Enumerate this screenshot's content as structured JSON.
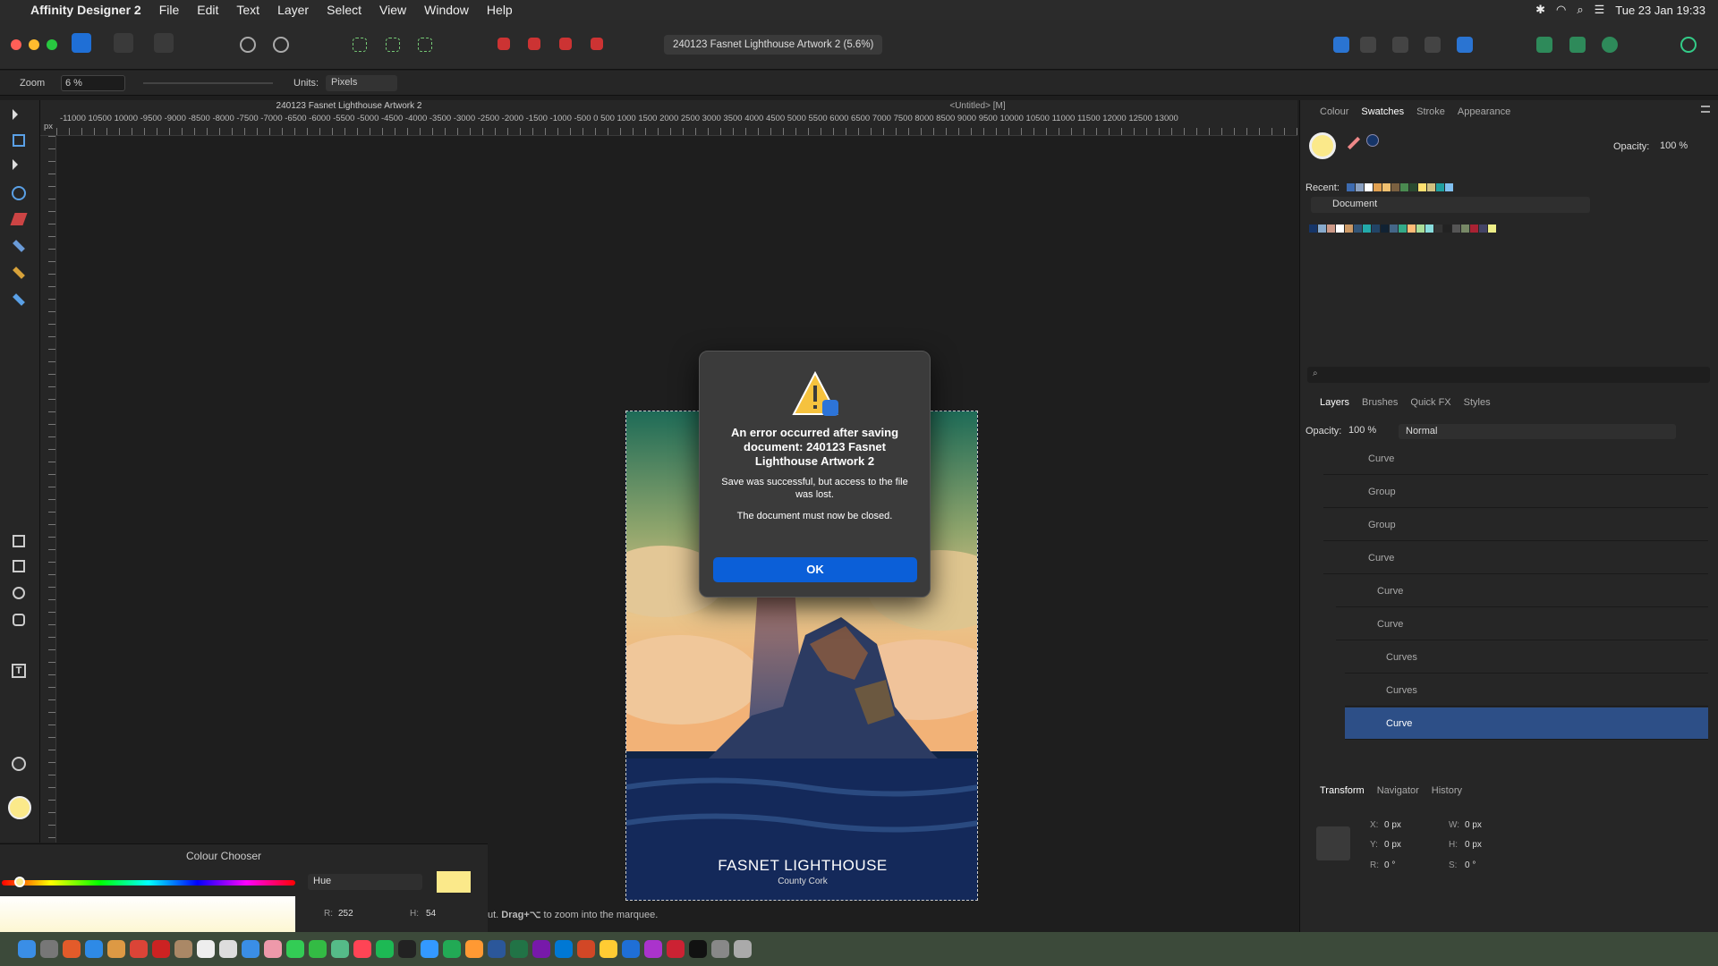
{
  "menubar": {
    "app": "Affinity Designer 2",
    "items": [
      "File",
      "Edit",
      "Text",
      "Layer",
      "Select",
      "View",
      "Window",
      "Help"
    ],
    "datetime": "Tue 23 Jan  19:33"
  },
  "toolbar": {
    "doc_title": "240123 Fasnet Lighthouse Artwork 2 (5.6%)"
  },
  "context": {
    "zoom_label": "Zoom",
    "zoom_value": "6 %",
    "units_label": "Units:",
    "units_value": "Pixels"
  },
  "tabs": {
    "active": "240123 Fasnet Lighthouse Artwork 2",
    "other": "<Untitled> [M]"
  },
  "ruler": {
    "unit": "px",
    "labels": "-11000 10500 10000 -9500 -9000 -8500 -8000 -7500 -7000 -6500 -6000 -5500 -5000 -4500 -4000 -3500 -3000 -2500 -2000 -1500 -1000 -500   0   500  1000  1500  2000  2500  3000  3500  4000  4500  5000  5500  6000  6500  7000  7500  8000  8500  9000  9500 10000 10500 11000 11500 12000 12500 13000"
  },
  "swatches_panel": {
    "tabs": [
      "Colour",
      "Swatches",
      "Stroke",
      "Appearance"
    ],
    "active": "Swatches",
    "opacity_label": "Opacity:",
    "opacity_value": "100 %",
    "recent_label": "Recent:",
    "palette": "Document"
  },
  "layers_panel": {
    "tabs": [
      "Layers",
      "Brushes",
      "Quick FX",
      "Styles"
    ],
    "active": "Layers",
    "opacity_label": "Opacity:",
    "opacity_value": "100 %",
    "blend_mode": "Normal",
    "rows": [
      {
        "name": "Curve"
      },
      {
        "name": "Group"
      },
      {
        "name": "Group"
      },
      {
        "name": "Curve"
      },
      {
        "name": "Curve"
      },
      {
        "name": "Curve"
      },
      {
        "name": "Curves"
      },
      {
        "name": "Curves"
      },
      {
        "name": "Curve"
      }
    ]
  },
  "transform_panel": {
    "tabs": [
      "Transform",
      "Navigator",
      "History"
    ],
    "active": "Transform",
    "x_label": "X:",
    "x": "0 px",
    "y_label": "Y:",
    "y": "0 px",
    "w_label": "W:",
    "w": "0 px",
    "h_label": "H:",
    "h": "0 px",
    "r_label": "R:",
    "r": "0 °",
    "s_label": "S:",
    "s": "0 °"
  },
  "colour_chooser": {
    "title": "Colour Chooser",
    "mode": "Hue",
    "r_label": "R:",
    "r": "252",
    "h_label": "H:",
    "h": "54"
  },
  "artwork": {
    "title": "FASNET LIGHTHOUSE",
    "subtitle": "County Cork"
  },
  "status": {
    "hint_prefix": "ut. ",
    "hint_bold": "Drag+⌥",
    "hint_suffix": " to zoom into the marquee."
  },
  "dialog": {
    "heading": "An error occurred after saving document: 240123 Fasnet Lighthouse Artwork 2",
    "message": "Save was successful, but access to the file was lost.",
    "note": "The document must now be closed.",
    "ok_label": "OK"
  },
  "colors": {
    "accent": "#0b5fd8",
    "selected_layer": "#2d4f87",
    "swatch_yellow": "#fbe98a"
  }
}
